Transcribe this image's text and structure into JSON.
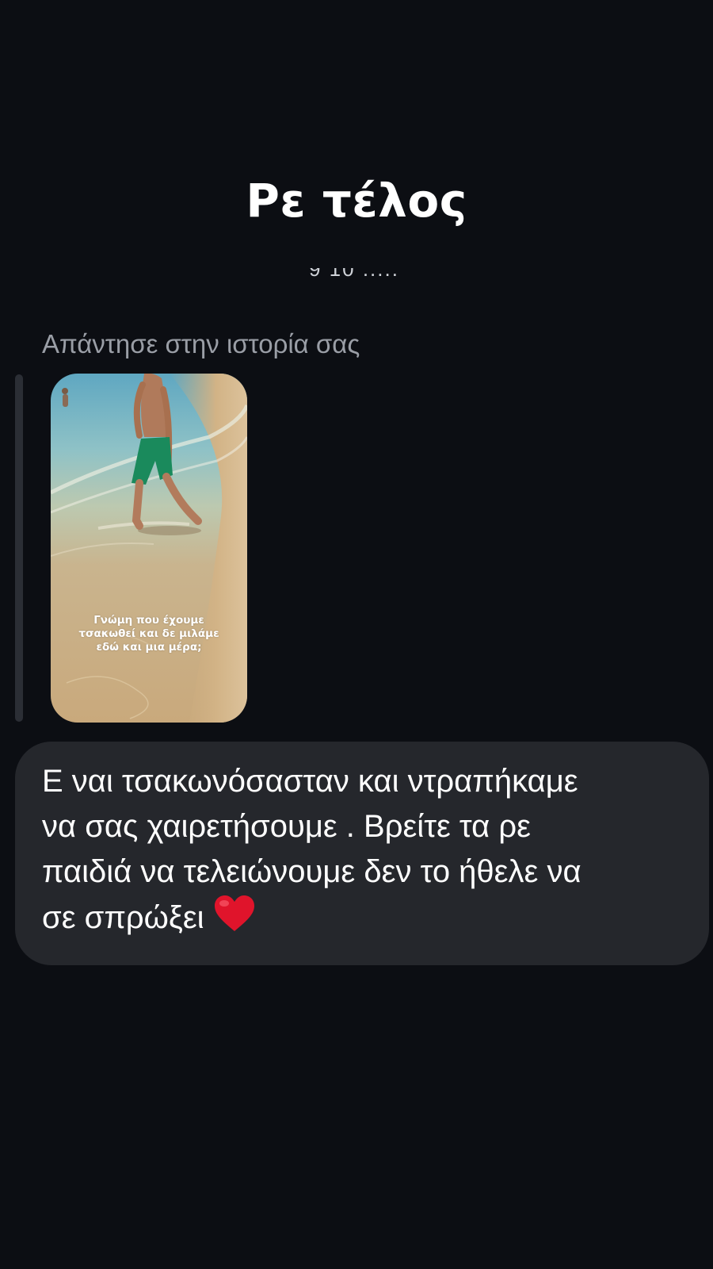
{
  "conversation": {
    "title": "Ρε τέλος",
    "clipped_timestamp": "9 10 ....."
  },
  "story_reply": {
    "label": "Απάντησε στην ιστορία σας",
    "story_caption": "Γνώμη που έχουμε\nτσακωθεί και δε μιλάμε\nεδώ και μια μέρα;"
  },
  "message": {
    "text": "Ε ναι τσακωνόσασταν και ντραπήκαμε\nνα σας χαιρετήσουμε . Βρείτε τα ρε\nπαιδιά να τελειώνουμε δεν το ήθελε να\nσε σπρώξει",
    "emoji_icon": "red-heart-icon"
  },
  "colors": {
    "background": "#0c0e13",
    "bubble": "#25272c",
    "label": "#9a9ea6",
    "heart": "#e0142b"
  }
}
